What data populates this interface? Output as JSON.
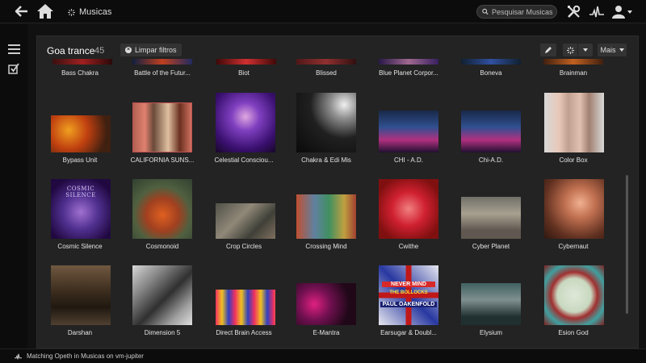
{
  "topbar": {
    "breadcrumb": "Musicas",
    "search_placeholder": "Pesquisar Musicas"
  },
  "panel": {
    "title": "Goa trance",
    "count": "45",
    "clear_filters_label": "Limpar filtros",
    "more_label": "Mais"
  },
  "items": [
    {
      "label": "Bass Chakra"
    },
    {
      "label": "Battle of the Futur..."
    },
    {
      "label": "Biot"
    },
    {
      "label": "Blissed"
    },
    {
      "label": "Blue Planet Corpor..."
    },
    {
      "label": "Boneva"
    },
    {
      "label": "Brainman"
    },
    {
      "label": "Bypass Unit"
    },
    {
      "label": "CALIFORNIA SUNS..."
    },
    {
      "label": "Celestial Consciou..."
    },
    {
      "label": "Chakra & Edi Mis"
    },
    {
      "label": "CHI - A.D."
    },
    {
      "label": "Chi-A.D."
    },
    {
      "label": "Color Box"
    },
    {
      "label": "Cosmic Silence"
    },
    {
      "label": "Cosmonoid"
    },
    {
      "label": "Crop Circles"
    },
    {
      "label": "Crossing Mind"
    },
    {
      "label": "Cwithe"
    },
    {
      "label": "Cyber Planet"
    },
    {
      "label": "Cybernaut"
    },
    {
      "label": "Darshan"
    },
    {
      "label": "Dimension 5"
    },
    {
      "label": "Direct Brain Access"
    },
    {
      "label": "E-Mantra"
    },
    {
      "label": "Earsugar & Doubl..."
    },
    {
      "label": "Elysium"
    },
    {
      "label": "Esion God"
    }
  ],
  "cover_art_text": {
    "cosmic_silence": "COSMIC SILENCE",
    "earsugar_line1": "NEVER MIND",
    "earsugar_line2": "THE BOLLOCKS",
    "earsugar_line3": "PAUL OAKENFOLD"
  },
  "statusbar": {
    "text": "Matching Opeth in Musicas on vm-jupiter"
  }
}
